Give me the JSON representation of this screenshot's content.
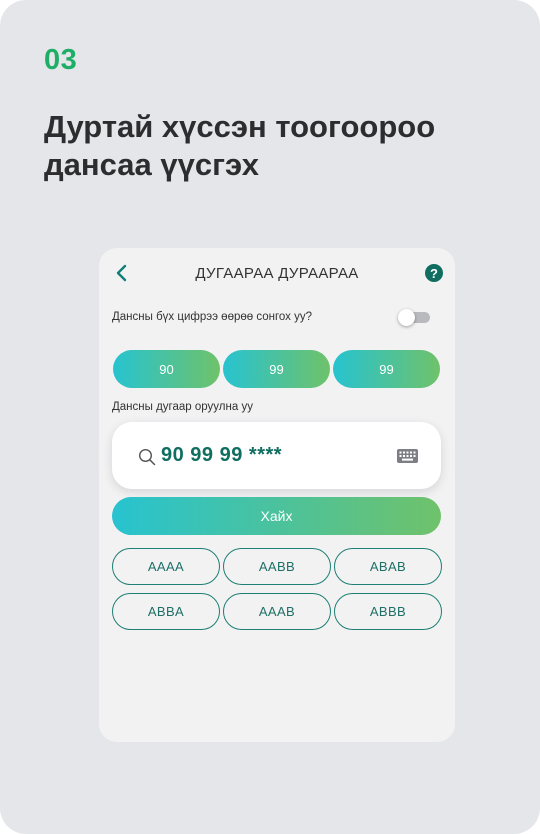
{
  "slide": {
    "step": "03",
    "headline_line1": "Дуртай хүссэн тоогоороо",
    "headline_line2": "дансаа үүсгэх"
  },
  "screen": {
    "title": "ДУГААРАА ДУРААРАА",
    "back_icon": "chevron-left-icon",
    "help_icon": "question-icon",
    "help_glyph": "?",
    "switch_label": "Дансны бүх цифрээ өөрөө сонгох уу?",
    "switch_on": false,
    "prefix_chips": [
      "90",
      "99",
      "99"
    ],
    "input_label": "Дансны дугаар оруулна уу",
    "search_value": "90 99 99 ****",
    "search_button": "Хайх",
    "patterns": [
      "AAAA",
      "AABB",
      "ABAB",
      "ABBA",
      "AAAB",
      "ABBB"
    ]
  },
  "colors": {
    "accent_green": "#1fae68",
    "teal": "#0f6e60",
    "gradient_start": "#27c3d0",
    "gradient_end": "#6fc26a",
    "background": "#e5e6ea"
  }
}
